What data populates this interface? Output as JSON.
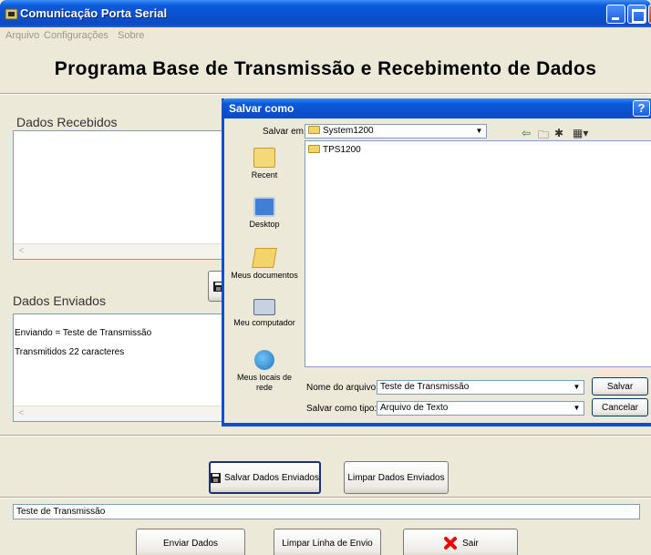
{
  "window": {
    "title": "Comunicação Porta Serial"
  },
  "menu": [
    "Arquivo",
    "Configurações",
    "Sobre"
  ],
  "heading": "Programa Base de Transmissão e Recebimento de Dados",
  "received": {
    "label": "Dados Recebidos"
  },
  "sent": {
    "label": "Dados Enviados",
    "lines": [
      "Enviando = Teste de Transmissão",
      "Transmitidos 22 caracteres"
    ]
  },
  "buttons": {
    "save_sent": "Salvar Dados Enviados",
    "clear_sent": "Limpar Dados Enviados",
    "send": "Enviar Dados",
    "clear_line": "Limpar Linha de Envio",
    "exit": "Sair"
  },
  "send_input": {
    "value": "Teste de Transmissão"
  },
  "dialog": {
    "title": "Salvar como",
    "help_glyph": "?",
    "save_in_label": "Salvar em:",
    "save_in_value": "System1200",
    "places": [
      {
        "label": "Recent",
        "icon": "recent-folder-icon"
      },
      {
        "label": "Desktop",
        "icon": "desktop-icon"
      },
      {
        "label": "Meus documentos",
        "icon": "my-documents-icon"
      },
      {
        "label": "Meu computador",
        "icon": "my-computer-icon"
      },
      {
        "label": "Meus locais de rede",
        "icon": "network-places-icon"
      }
    ],
    "files": [
      "TPS1200"
    ],
    "filename_label": "Nome do arquivo:",
    "filename_value": "Teste de Transmissão",
    "filetype_label": "Salvar como tipo:",
    "filetype_value": "Arquivo de Texto",
    "save_button": "Salvar",
    "cancel_button": "Cancelar"
  },
  "colors": {
    "titlebar": "#0A4FCB",
    "face": "#ECE9D8",
    "accent_thumb": "#0A1F9A",
    "exit_icon": "#E00000"
  }
}
